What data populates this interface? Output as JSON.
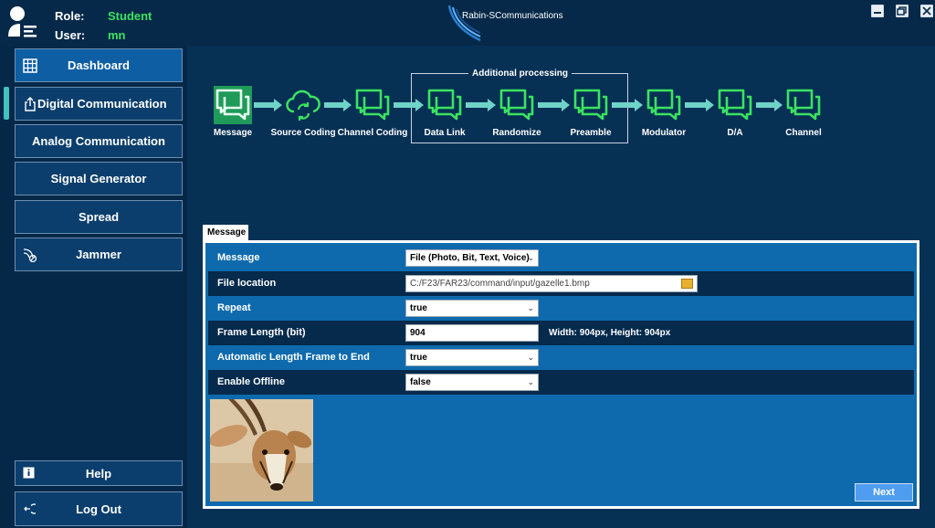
{
  "header": {
    "role_label": "Role:",
    "role_value": "Student",
    "user_label": "User:",
    "user_value": "mn",
    "brand": "Rabin-SCommunications"
  },
  "sidebar": {
    "items": [
      {
        "label": "Dashboard",
        "icon": "grid-icon"
      },
      {
        "label": "Digital Communication",
        "icon": "export-icon"
      },
      {
        "label": "Analog Communication"
      },
      {
        "label": "Signal Generator"
      },
      {
        "label": "Spread"
      },
      {
        "label": "Jammer",
        "icon": "jammer-icon"
      }
    ],
    "help_label": "Help",
    "logout_label": "Log Out"
  },
  "pipeline": {
    "group_label": "Additional processing",
    "stages": [
      "Message",
      "Source Coding",
      "Channel Coding",
      "Data Link",
      "Randomize",
      "Preamble",
      "Modulator",
      "D/A",
      "Channel"
    ]
  },
  "panel": {
    "tab_label": "Message",
    "rows": [
      {
        "label": "Message",
        "value": "File (Photo, Bit, Text, Voice)"
      },
      {
        "label": "File location",
        "value": "C:/F23/FAR23/command/input/gazelle1.bmp"
      },
      {
        "label": "Repeat",
        "value": "true"
      },
      {
        "label": "Frame Length (bit)",
        "value": "904"
      },
      {
        "label": "Automatic Length Frame to End",
        "value": "true"
      },
      {
        "label": "Enable Offline",
        "value": "false"
      }
    ],
    "dims_text": "Width: 904px, Height: 904px",
    "next_label": "Next"
  },
  "colors": {
    "background": "#073055",
    "accent_green": "#3be35f",
    "node_green": "#1f9a59",
    "arrow_teal": "#6fd3c8",
    "panel_blue": "#0e6aad"
  }
}
